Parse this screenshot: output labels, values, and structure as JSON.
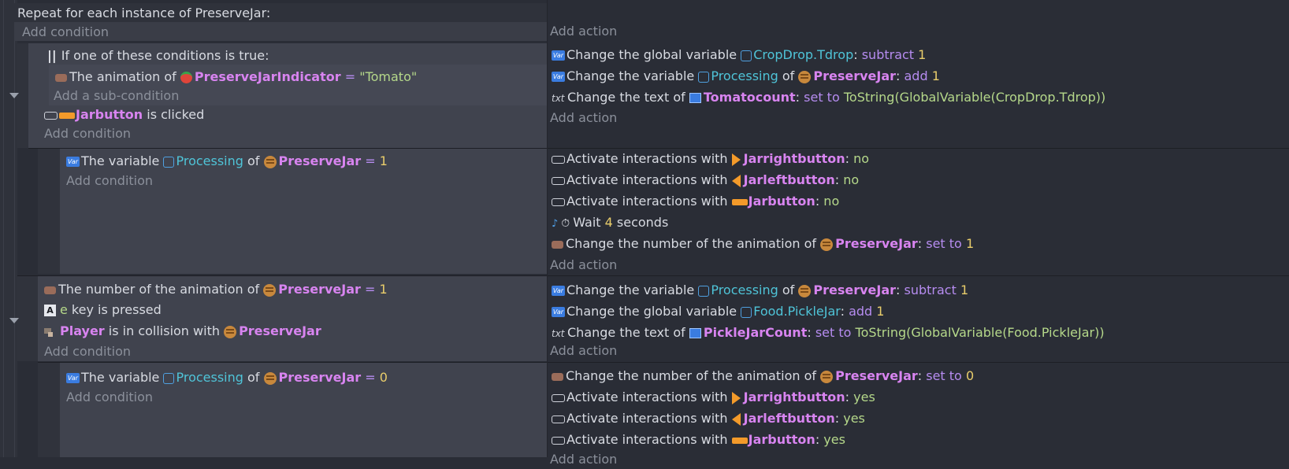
{
  "repeat_header": {
    "prefix": "Repeat for each instance of ",
    "object": "PreserveJar",
    "suffix": ":"
  },
  "labels": {
    "add_condition": "Add condition",
    "add_action": "Add action",
    "add_sub_condition": "Add a sub-condition"
  },
  "w": {
    "if_one_true": "If one of these conditions is true:",
    "the_animation_of": "The animation of ",
    "the_number_of_animation_of": "The number of the animation of ",
    "is_clicked": " is clicked",
    "key_pressed": " key is pressed",
    "in_collision_with": " is in collision with ",
    "the_variable": "The variable ",
    "of": " of ",
    "change_global_variable": "Change the global variable ",
    "change_variable": "Change the variable ",
    "change_text_of": "Change the text of ",
    "activate_interactions_with": "Activate interactions with ",
    "change_number_of_animation_of": "Change the number of the animation of ",
    "wait": "Wait ",
    "seconds": " seconds",
    "colon": ": ",
    "eq": " = ",
    "subtract": "subtract",
    "add": "add",
    "set_to": "set to",
    "no": "no",
    "yes": "yes"
  },
  "objects": {
    "preserve_jar": "PreserveJar",
    "preserve_jar_indicator": "PreserveJarIndicator",
    "jarbutton": "Jarbutton",
    "jarrightbutton": "Jarrightbutton",
    "jarleftbutton": "Jarleftbutton",
    "tomatocount": "Tomatocount",
    "pickle_jar_count": "PickleJarCount",
    "player": "Player"
  },
  "vars": {
    "crop_drop": "CropDrop.Tdrop",
    "processing": "Processing",
    "food_pickle": "Food.PickleJar"
  },
  "values": {
    "one": "1",
    "zero": "0",
    "four": "4",
    "tomato_str": "\"Tomato\"",
    "key_e": "e",
    "key_icon": "A",
    "tostring_crop": "ToString(GlobalVariable(CropDrop.Tdrop))",
    "tostring_pickle": "ToString(GlobalVariable(Food.PickleJar))"
  },
  "icons": {
    "var_badge": "Var"
  },
  "colors": {
    "background": "#2a2d36",
    "condition_panel": "#40434e",
    "object_name": "#d884f0",
    "variable_name": "#4fc4d8",
    "operator": "#b68cf0",
    "number": "#e9cd6b",
    "string": "#b5d88a",
    "muted_text": "#8b909b"
  }
}
